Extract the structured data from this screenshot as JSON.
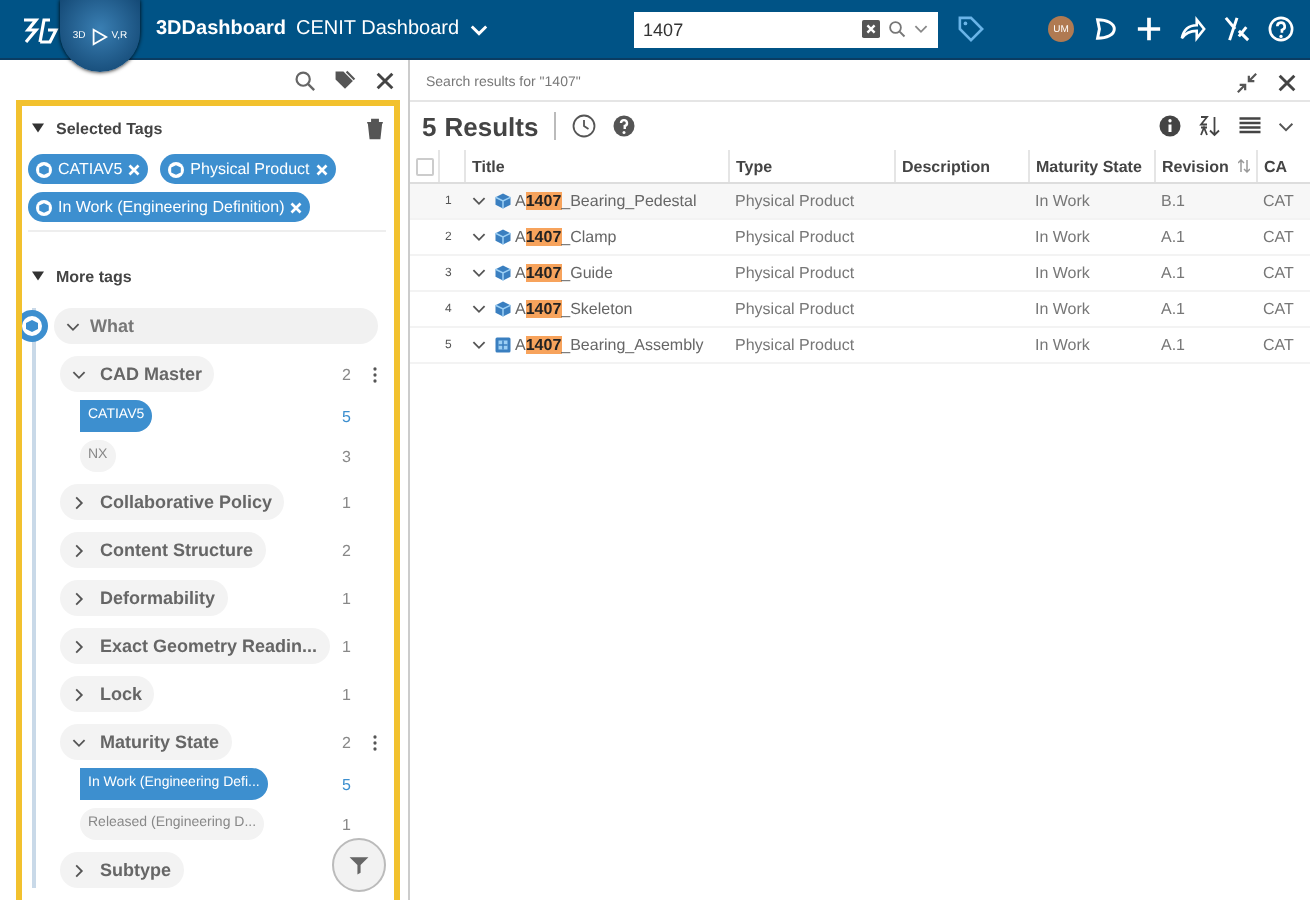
{
  "top_bar": {
    "compass_labels": [
      "3D",
      "V,R"
    ],
    "app_name": "3DDashboard",
    "dashboard_name": "CENIT Dashboard",
    "search": {
      "value": "1407"
    },
    "avatar": "UM"
  },
  "tag_panel": {
    "selected_tags": {
      "title": "Selected Tags",
      "expanded": true,
      "tags": [
        "CATIAV5",
        "Physical Product",
        "In Work (Engineering Definition)"
      ]
    },
    "more_tags": {
      "title": "More tags",
      "expanded": true,
      "group": {
        "label": "What",
        "expanded": true,
        "children": [
          {
            "label": "CAD Master",
            "count": "2",
            "expanded": true,
            "values": [
              {
                "label": "CATIAV5",
                "count": "5",
                "selected": true
              },
              {
                "label": "NX",
                "count": "3",
                "selected": false
              }
            ]
          },
          {
            "label": "Collaborative Policy",
            "count": "1",
            "expanded": false
          },
          {
            "label": "Content Structure",
            "count": "2",
            "expanded": false
          },
          {
            "label": "Deformability",
            "count": "1",
            "expanded": false
          },
          {
            "label": "Exact Geometry Readin...",
            "count": "1",
            "expanded": false
          },
          {
            "label": "Lock",
            "count": "1",
            "expanded": false
          },
          {
            "label": "Maturity State",
            "count": "2",
            "expanded": true,
            "values": [
              {
                "label": "In Work (Engineering Defi...",
                "count": "5",
                "selected": true
              },
              {
                "label": "Released (Engineering D...",
                "count": "1",
                "selected": false
              }
            ]
          },
          {
            "label": "Subtype",
            "expanded": false
          }
        ]
      }
    }
  },
  "results": {
    "caption": "Search results for \"1407\"",
    "count": "5",
    "label": "Results",
    "table": {
      "select_all": {
        "checked": false
      },
      "columns": [
        "Title",
        "Type",
        "Description",
        "Maturity State",
        "Revision",
        "CA"
      ],
      "rows": [
        {
          "index": "1",
          "title": "A**1407**_Bearing_Pedestal",
          "kind": "part",
          "type": "Physical Product",
          "description": "",
          "maturity": "In Work",
          "revision": "B.1",
          "cad": "CAT"
        },
        {
          "index": "2",
          "title": "A**1407**_Clamp",
          "kind": "part",
          "type": "Physical Product",
          "description": "",
          "maturity": "In Work",
          "revision": "A.1",
          "cad": "CAT"
        },
        {
          "index": "3",
          "title": "A**1407**_Guide",
          "kind": "part",
          "type": "Physical Product",
          "description": "",
          "maturity": "In Work",
          "revision": "A.1",
          "cad": "CAT"
        },
        {
          "index": "4",
          "title": "A**1407**_Skeleton",
          "kind": "part",
          "type": "Physical Product",
          "description": "",
          "maturity": "In Work",
          "revision": "A.1",
          "cad": "CAT"
        },
        {
          "index": "5",
          "title": "A**1407**_Bearing_Assembly",
          "kind": "assembly",
          "type": "Physical Product",
          "description": "",
          "maturity": "In Work",
          "revision": "A.1",
          "cad": "CAT"
        }
      ]
    }
  }
}
